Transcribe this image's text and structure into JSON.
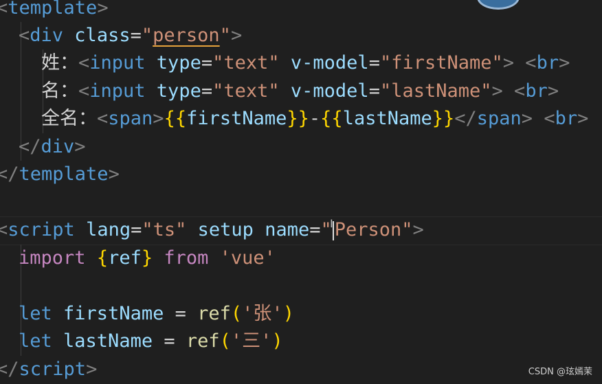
{
  "editor": {
    "lines": [
      {
        "tokens": [
          "<",
          "template",
          ">"
        ]
      },
      {
        "tokens": [
          "<",
          "div",
          " class",
          "=",
          "\"",
          "person",
          "\"",
          ">"
        ]
      },
      {
        "tokens": [
          "姓：",
          "<",
          "input",
          " type",
          "=",
          "\"text\"",
          " v-model",
          "=",
          "\"firstName\"",
          ">",
          " ",
          "<",
          "br",
          ">"
        ]
      },
      {
        "tokens": [
          "名：",
          "<",
          "input",
          " type",
          "=",
          "\"text\"",
          " v-model",
          "=",
          "\"lastName\"",
          ">",
          " ",
          "<",
          "br",
          ">"
        ]
      },
      {
        "tokens": [
          "全名：",
          "<",
          "span",
          ">",
          "{{",
          "firstName",
          "}}",
          "-",
          "{{",
          "lastName",
          "}}",
          "</",
          "span",
          ">",
          " ",
          "<",
          "br",
          ">"
        ]
      },
      {
        "tokens": [
          "</",
          "div",
          ">"
        ]
      },
      {
        "tokens": [
          "</",
          "template",
          ">"
        ]
      },
      {
        "tokens": []
      },
      {
        "tokens": [
          "<",
          "script",
          " lang",
          "=",
          "\"ts\"",
          " setup",
          " name",
          "=",
          "\"",
          "Person\"",
          ">"
        ]
      },
      {
        "tokens": [
          "import",
          " ",
          "{",
          "ref",
          "}",
          " from",
          " 'vue'"
        ]
      },
      {
        "tokens": []
      },
      {
        "tokens": [
          "let",
          " firstName",
          " = ",
          "ref",
          "(",
          "'张'",
          ")"
        ]
      },
      {
        "tokens": [
          "let",
          " lastName",
          " = ",
          "ref",
          "(",
          "'三'",
          ")"
        ]
      },
      {
        "tokens": [
          "</",
          "script",
          ">"
        ]
      }
    ]
  },
  "watermark": "CSDN @玹嫣茉"
}
